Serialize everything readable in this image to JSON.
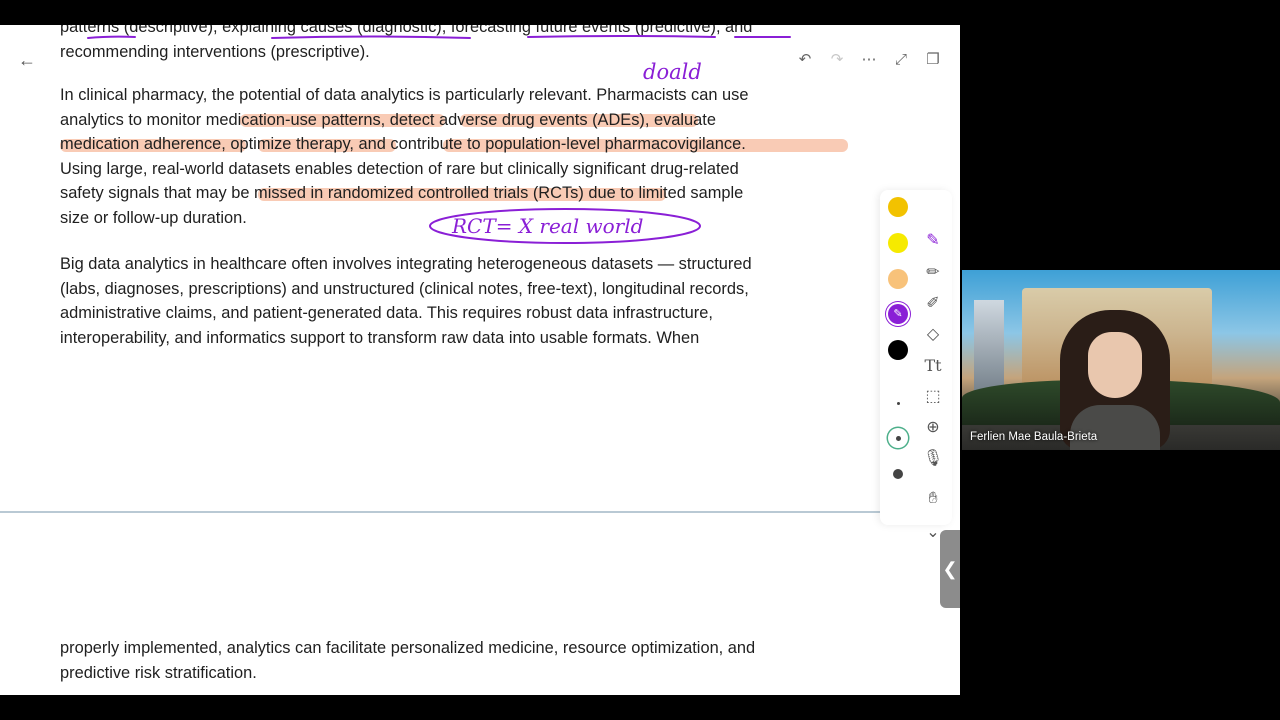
{
  "document": {
    "paragraphs": [
      {
        "lines": [
          "patterns (descriptive), explaining causes (diagnostic), forecasting future events (predictive), and",
          "recommending interventions (prescriptive)."
        ]
      },
      {
        "lines": [
          "In clinical pharmacy, the potential of data analytics is particularly relevant. Pharmacists can use",
          "analytics to monitor medication-use patterns, detect adverse drug events (ADEs), evaluate",
          "medication adherence, optimize therapy, and contribute to population-level pharmacovigilance.",
          "Using large, real-world datasets enables detection of rare but clinically significant drug-related",
          "safety signals that may be missed in randomized controlled trials (RCTs) due to limited sample",
          "size or follow-up duration."
        ]
      },
      {
        "lines": [
          "Big data analytics in healthcare often involves integrating heterogeneous datasets — structured",
          "(labs, diagnoses, prescriptions) and unstructured (clinical notes, free-text), longitudinal records,",
          "administrative claims, and patient-generated data. This requires robust data infrastructure,",
          "interoperability, and informatics support to transform raw data into usable formats. When"
        ]
      },
      {
        "lines": [
          "properly implemented, analytics can facilitate personalized medicine, resource optimization, and",
          "predictive risk stratification."
        ]
      }
    ],
    "annotations": {
      "handwritten_1": "doald",
      "handwritten_2": "RCT= X real world"
    }
  },
  "toolbar": {
    "back_icon": "arrow-left-icon",
    "undo_icon": "undo-icon",
    "redo_icon": "redo-icon",
    "more_icon": "more-icon",
    "export_icon": "export-icon",
    "copy_icon": "copy-icon"
  },
  "pen_panel": {
    "colors": [
      "#f2c200",
      "#f6ea00",
      "#f8c27a",
      "#8a1fd6",
      "#000000"
    ],
    "tools": [
      "pen-icon",
      "pencil-icon",
      "highlighter-icon",
      "eraser-icon",
      "text-icon",
      "lasso-icon",
      "add-icon",
      "mic-icon",
      "hand-icon",
      "chevron-down-icon"
    ]
  },
  "video": {
    "participant_name": "Ferlien Mae Baula-Brieta"
  },
  "colors": {
    "highlight": "#f4a078",
    "ink": "#8a1fd6"
  }
}
